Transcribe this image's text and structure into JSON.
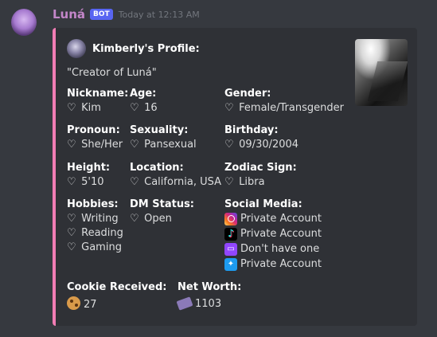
{
  "message": {
    "username": "Luná",
    "bot_tag": "BOT",
    "timestamp": "Today at 12:13 AM"
  },
  "embed": {
    "accent_color": "#f17db4",
    "author": "Kimberly's Profile:",
    "description": "\"Creator of Luná\"",
    "heart_symbol": "♡",
    "fields": {
      "nickname": {
        "name": "Nickname:",
        "value": "Kim"
      },
      "age": {
        "name": "Age:",
        "value": "16"
      },
      "gender": {
        "name": "Gender:",
        "value": "Female/Transgender"
      },
      "pronoun": {
        "name": "Pronoun:",
        "value": "She/Her"
      },
      "sexuality": {
        "name": "Sexuality:",
        "value": "Pansexual"
      },
      "birthday": {
        "name": "Birthday:",
        "value": "09/30/2004"
      },
      "height": {
        "name": "Height:",
        "value": "5'10"
      },
      "location": {
        "name": "Location:",
        "value": "California, USA"
      },
      "zodiac": {
        "name": "Zodiac Sign:",
        "value": "Libra"
      },
      "hobbies": {
        "name": "Hobbies:",
        "values": [
          "Writing",
          "Reading",
          "Gaming"
        ]
      },
      "dm_status": {
        "name": "DM Status:",
        "value": "Open"
      },
      "social_media": {
        "name": "Social Media:",
        "items": [
          {
            "icon": "instagram-icon",
            "value": "Private Account"
          },
          {
            "icon": "tiktok-icon",
            "value": "Private Account"
          },
          {
            "icon": "twitch-icon",
            "value": "Don't have one"
          },
          {
            "icon": "twitter-icon",
            "value": "Private Account"
          }
        ]
      },
      "cookies": {
        "name": "Cookie Received:",
        "icon": "cookie-icon",
        "value": "27"
      },
      "net_worth": {
        "name": "Net Worth:",
        "icon": "money-icon",
        "value": "1103"
      }
    }
  }
}
